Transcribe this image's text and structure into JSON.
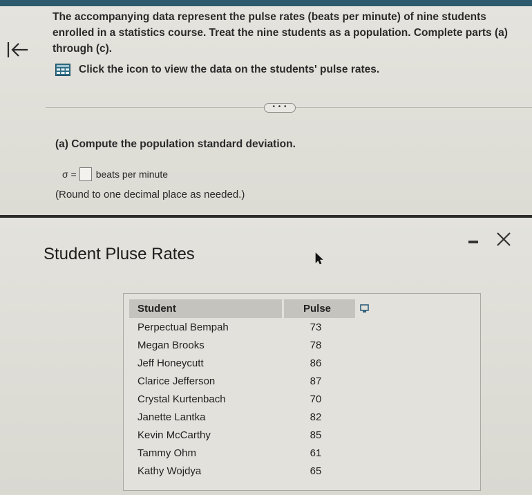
{
  "question": {
    "intro": "The accompanying data represent the pulse rates (beats per minute) of nine students enrolled in a statistics course. Treat the nine students as a population. Complete parts (a) through (c).",
    "data_link": "Click the icon to view the data on the students' pulse rates.",
    "more_button": "• • •",
    "part_a": "(a) Compute the population standard deviation.",
    "sigma_label": "σ =",
    "units": "beats per minute",
    "round_note": "(Round to one decimal place as needed.)"
  },
  "popup": {
    "title": "Student Pluse Rates",
    "table": {
      "headers": [
        "Student",
        "Pulse"
      ],
      "rows": [
        [
          "Perpectual Bempah",
          "73"
        ],
        [
          "Megan Brooks",
          "78"
        ],
        [
          "Jeff Honeycutt",
          "86"
        ],
        [
          "Clarice Jefferson",
          "87"
        ],
        [
          "Crystal Kurtenbach",
          "70"
        ],
        [
          "Janette Lantka",
          "82"
        ],
        [
          "Kevin McCarthy",
          "85"
        ],
        [
          "Tammy Ohm",
          "61"
        ],
        [
          "Kathy Wojdya",
          "65"
        ]
      ]
    }
  },
  "colors": {
    "top_bar": "#2d5a6c",
    "popup_border": "#2c2c2a",
    "header_bg": "#c4c3bd"
  },
  "icons": {
    "back": "back-to-start-icon",
    "data_table": "data-table-icon",
    "minimize": "minimize-icon",
    "close": "close-icon",
    "copy": "copy-icon",
    "cursor": "mouse-cursor-icon"
  }
}
